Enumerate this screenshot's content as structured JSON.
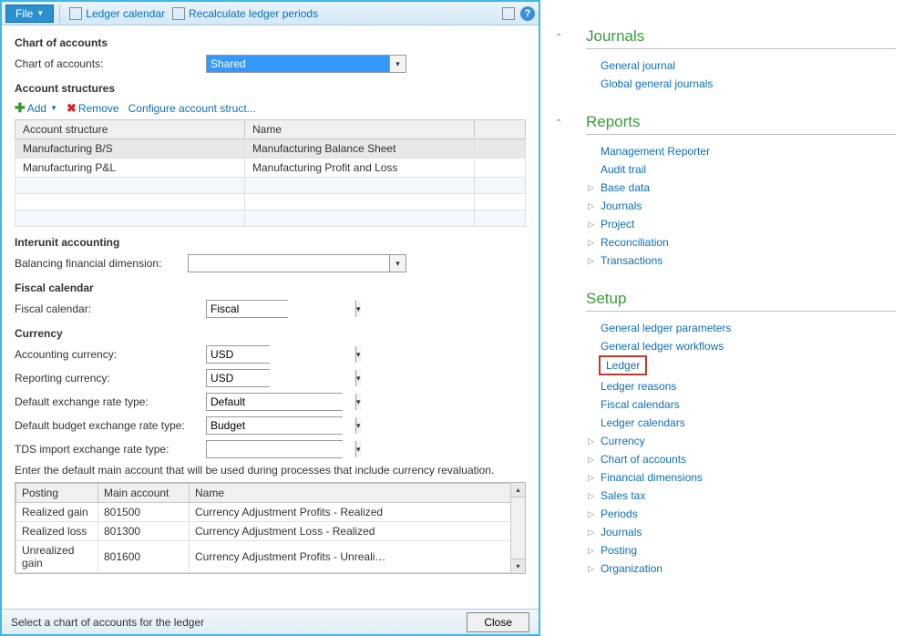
{
  "toolbar": {
    "file": "File",
    "ledger_calendar": "Ledger calendar",
    "recalc": "Recalculate ledger periods"
  },
  "sections": {
    "chart_of_accounts": "Chart of accounts",
    "account_structures": "Account structures",
    "interunit": "Interunit accounting",
    "fiscal": "Fiscal calendar",
    "currency": "Currency"
  },
  "labels": {
    "chart_of_accounts": "Chart of accounts:",
    "balancing_dim": "Balancing financial dimension:",
    "fiscal_calendar": "Fiscal calendar:",
    "accounting_currency": "Accounting currency:",
    "reporting_currency": "Reporting currency:",
    "default_exchange": "Default exchange rate type:",
    "default_budget": "Default budget exchange rate type:",
    "tds_import": "TDS import exchange rate type:"
  },
  "values": {
    "chart_of_accounts": "Shared",
    "balancing_dim": "",
    "fiscal_calendar": "Fiscal",
    "accounting_currency": "USD",
    "reporting_currency": "USD",
    "default_exchange": "Default",
    "default_budget": "Budget",
    "tds_import": ""
  },
  "buttons": {
    "add": "Add",
    "remove": "Remove",
    "configure": "Configure account struct...",
    "close": "Close"
  },
  "structures_grid": {
    "headers": {
      "structure": "Account structure",
      "name": "Name"
    },
    "rows": [
      {
        "structure": "Manufacturing B/S",
        "name": "Manufacturing Balance Sheet"
      },
      {
        "structure": "Manufacturing P&L",
        "name": "Manufacturing Profit and Loss"
      }
    ]
  },
  "currency_helper": "Enter the default main account that will be used during processes that include currency revaluation.",
  "posting_grid": {
    "headers": {
      "posting": "Posting",
      "main_account": "Main account",
      "name": "Name"
    },
    "rows": [
      {
        "posting": "Realized gain",
        "main_account": "801500",
        "name": "Currency Adjustment Profits - Realized"
      },
      {
        "posting": "Realized loss",
        "main_account": "801300",
        "name": "Currency Adjustment Loss - Realized"
      },
      {
        "posting": "Unrealized gain",
        "main_account": "801600",
        "name": "Currency Adjustment Profits - Unreali…"
      }
    ]
  },
  "status_text": "Select a chart of accounts for the ledger",
  "nav": {
    "journals": {
      "title": "Journals",
      "items": [
        "General journal",
        "Global general journals"
      ]
    },
    "reports": {
      "title": "Reports",
      "items": [
        "Management Reporter",
        "Audit trail"
      ],
      "expandable": [
        "Base data",
        "Journals",
        "Project",
        "Reconciliation",
        "Transactions"
      ]
    },
    "setup": {
      "title": "Setup",
      "items": [
        "General ledger parameters",
        "General ledger workflows",
        "Ledger",
        "Ledger reasons",
        "Fiscal calendars",
        "Ledger calendars"
      ],
      "highlighted": "Ledger",
      "expandable": [
        "Currency",
        "Chart of accounts",
        "Financial dimensions",
        "Sales tax",
        "Periods",
        "Journals",
        "Posting",
        "Organization"
      ]
    }
  }
}
